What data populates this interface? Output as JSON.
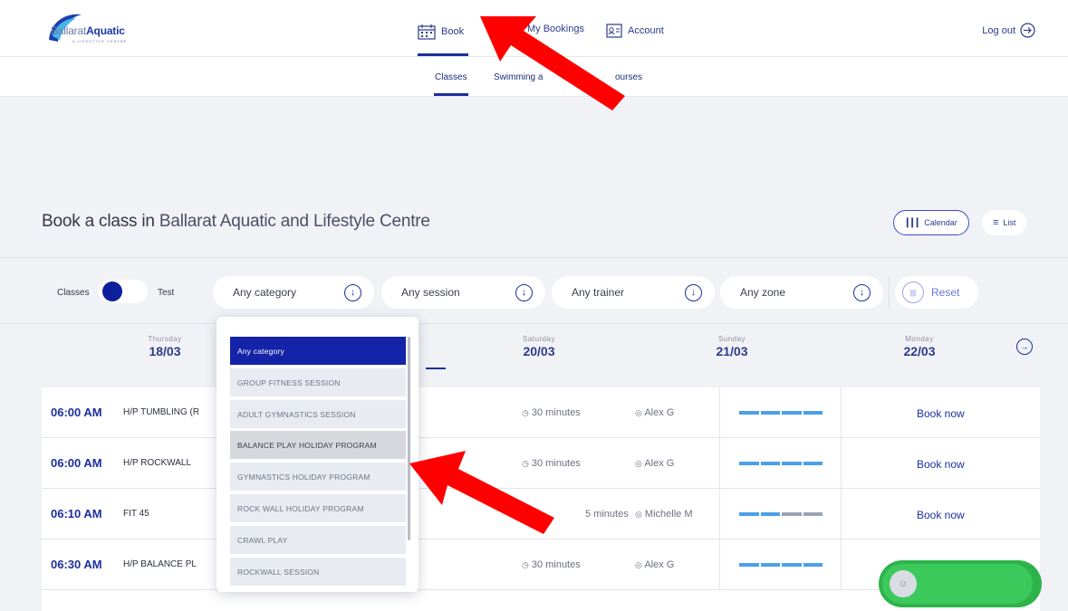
{
  "header": {
    "logo": {
      "brand_main": "Ballarat",
      "brand_accent": "Aquatic",
      "tagline": "& LIFESTYLE CENTRE"
    },
    "nav": [
      {
        "label": "Book",
        "icon": "calendar-icon",
        "active": true
      },
      {
        "label": "My Bookings",
        "icon": "bookings-icon",
        "active": false
      },
      {
        "label": "Account",
        "icon": "account-icon",
        "active": false
      }
    ],
    "logout_label": "Log out"
  },
  "subnav": {
    "tabs": [
      {
        "label": "Classes",
        "active": true
      },
      {
        "label": "Swimming a",
        "active": false
      },
      {
        "label": "ourses",
        "active": false
      }
    ]
  },
  "page": {
    "title_prefix": "Book a class in",
    "title_centre": "Ballarat Aquatic and Lifestyle Centre",
    "view_calendar": "Calendar",
    "view_list": "List"
  },
  "filters": {
    "toggle_left": "Classes",
    "toggle_right": "Test",
    "category": "Any category",
    "session": "Any session",
    "trainer": "Any trainer",
    "zone": "Any zone",
    "reset": "Reset"
  },
  "days": [
    {
      "name": "Thursday",
      "date": "18/03"
    },
    {
      "name": "Saturday",
      "date": "20/03"
    },
    {
      "name": "Sunday",
      "date": "21/03"
    },
    {
      "name": "Monday",
      "date": "22/03"
    }
  ],
  "schedule": [
    {
      "time": "06:00 AM",
      "name": "H/P TUMBLING (R",
      "duration": "30 minutes",
      "trainer": "Alex G",
      "capacity": [
        1,
        1,
        1,
        1
      ],
      "action": "Book now"
    },
    {
      "time": "06:00 AM",
      "name": "H/P ROCKWALL",
      "duration": "30 minutes",
      "trainer": "Alex G",
      "capacity": [
        1,
        1,
        1,
        1
      ],
      "action": "Book now"
    },
    {
      "time": "06:10 AM",
      "name": "FIT 45",
      "duration": "5 minutes",
      "trainer": "Michelle M",
      "capacity": [
        1,
        1,
        0,
        0
      ],
      "action": "Book now"
    },
    {
      "time": "06:30 AM",
      "name": "H/P BALANCE PL",
      "duration": "30 minutes",
      "trainer": "Alex G",
      "capacity": [
        1,
        1,
        1,
        1
      ],
      "action": ""
    }
  ],
  "category_dropdown": {
    "options": [
      "Any category",
      "GROUP FITNESS SESSION",
      "ADULT GYMNASTICS SESSION",
      "BALANCE PLAY HOLIDAY PROGRAM",
      "GYMNASTICS HOLIDAY PROGRAM",
      "ROCK WALL HOLIDAY PROGRAM",
      "CRAWL PLAY",
      "ROCKWALL SESSION"
    ],
    "selected_index": 0,
    "hovered_index": 3
  },
  "colors": {
    "primary": "#1c2f9e",
    "selected_option": "#1423a8",
    "capacity_bar": "#4aa0e6",
    "chat_widget": "#2db34a",
    "annotation_arrow": "#ff0000"
  }
}
